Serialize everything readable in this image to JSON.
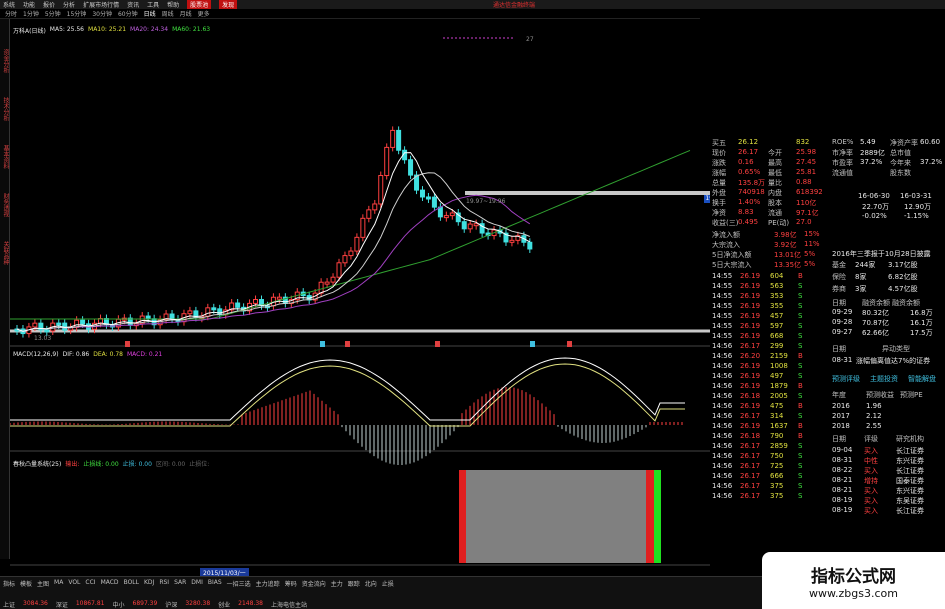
{
  "menubar": {
    "items": [
      "系统",
      "功能",
      "报价",
      "分析",
      "扩展市场行情",
      "资讯",
      "工具",
      "帮助"
    ],
    "btn1": "股票池",
    "btn2": "发现",
    "brand": "通达信金融终端"
  },
  "periodbar": {
    "items": [
      "分时",
      "1分钟",
      "5分钟",
      "15分钟",
      "30分钟",
      "60分钟",
      "日线",
      "周线",
      "月线",
      "更多"
    ],
    "active_index": 6
  },
  "sidebar": {
    "items": [
      "资金分析",
      "技术分析",
      "基本资料",
      "财务透视",
      "关联品种"
    ]
  },
  "ma_legend": {
    "title": "万科A(日线)",
    "ma5": "MA5: 25.56",
    "ma10": "MA10: 25.21",
    "ma20": "MA20: 24.34",
    "ma60": "MA60: 21.63"
  },
  "main_chart": {
    "high_label": "27",
    "annotation": "19.97~19.96",
    "low_label": "13.03",
    "price_tag": "19.36"
  },
  "macd_legend": {
    "name": "MACD(12,26,9)",
    "dif": "DIF: 0.86",
    "dea": "DEA: 0.78",
    "macd": "MACD: 0.21"
  },
  "ind_legend": {
    "name": "春秋凸量系统(25)",
    "a": "输出:",
    "b": "止损线: 0.00",
    "c": "止损: 0.00",
    "d": "区间: 0.00",
    "e": "止损位:"
  },
  "date_box": "2015/11/03/一",
  "right_panel": {
    "quote": [
      {
        "label": "买五",
        "value": "26.12",
        "vol": "832"
      },
      {
        "label": "现价",
        "value": "26.17",
        "l2": "今开",
        "v2": "25.98"
      },
      {
        "label": "涨跌",
        "value": "0.16",
        "l2": "最高",
        "v2": "27.45"
      },
      {
        "label": "涨幅",
        "value": "0.65%",
        "l2": "最低",
        "v2": "25.81"
      },
      {
        "label": "总量",
        "value": "135.8万",
        "l2": "量比",
        "v2": "0.88"
      },
      {
        "label": "外盘",
        "value": "740918",
        "l2": "内盘",
        "v2": "618392"
      },
      {
        "label": "换手",
        "value": "1.40%",
        "l2": "股本",
        "v2": "110亿"
      },
      {
        "label": "净资",
        "value": "8.83",
        "l2": "流通",
        "v2": "97.1亿"
      },
      {
        "label": "收益(三)",
        "value": "0.495",
        "l2": "PE(动)",
        "v2": "27.0"
      }
    ],
    "flows": [
      {
        "label": "净流入额",
        "value": "3.98亿",
        "pct": "15%"
      },
      {
        "label": "大宗流入",
        "value": "3.92亿",
        "pct": "11%"
      },
      {
        "label": "5日净流入额",
        "value": "13.01亿",
        "pct": "5%"
      },
      {
        "label": "5日大宗流入",
        "value": "13.35亿",
        "pct": "5%"
      }
    ],
    "ticks": [
      [
        "14:55",
        "26.19",
        "604",
        "B"
      ],
      [
        "14:55",
        "26.19",
        "563",
        "S"
      ],
      [
        "14:55",
        "26.19",
        "353",
        "S"
      ],
      [
        "14:55",
        "26.19",
        "355",
        "S"
      ],
      [
        "14:55",
        "26.19",
        "457",
        "S"
      ],
      [
        "14:55",
        "26.19",
        "597",
        "S"
      ],
      [
        "14:55",
        "26.19",
        "668",
        "S"
      ],
      [
        "14:56",
        "26.17",
        "299",
        "S"
      ],
      [
        "14:56",
        "26.20",
        "2159",
        "B"
      ],
      [
        "14:56",
        "26.19",
        "1008",
        "S"
      ],
      [
        "14:56",
        "26.19",
        "497",
        "S"
      ],
      [
        "14:56",
        "26.19",
        "1879",
        "B"
      ],
      [
        "14:56",
        "26.18",
        "2005",
        "S"
      ],
      [
        "14:56",
        "26.19",
        "475",
        "B"
      ],
      [
        "14:56",
        "26.17",
        "314",
        "S"
      ],
      [
        "14:56",
        "26.19",
        "1637",
        "B"
      ],
      [
        "14:56",
        "26.18",
        "790",
        "B"
      ],
      [
        "14:56",
        "26.17",
        "2859",
        "S"
      ],
      [
        "14:56",
        "26.17",
        "750",
        "S"
      ],
      [
        "14:56",
        "26.17",
        "725",
        "S"
      ],
      [
        "14:56",
        "26.17",
        "666",
        "S"
      ],
      [
        "14:56",
        "26.17",
        "375",
        "S"
      ],
      [
        "14:56",
        "26.17",
        "375",
        "S"
      ]
    ],
    "f10": {
      "rows": [
        [
          "ROE%",
          "5.49",
          "净资产率",
          "60.60"
        ],
        [
          "市净率",
          "2889亿",
          "总市值",
          ""
        ],
        [
          "市盈率",
          "37.2%",
          "今年来",
          "37.2%"
        ],
        [
          "流通值",
          "",
          "股东数",
          ""
        ]
      ],
      "dates": [
        [
          "16-06-30",
          "16-03-31"
        ]
      ],
      "vals": [
        [
          "22.70万",
          "12.90万"
        ],
        [
          "-0.02%",
          "-1.15%"
        ]
      ],
      "report": "2016年三季报于10月28日披露",
      "cats": [
        [
          "基金",
          "244家",
          "3.17亿股"
        ],
        [
          "保险",
          "8家",
          "6.82亿股"
        ],
        [
          "券商",
          "3家",
          "4.57亿股"
        ]
      ],
      "margin_header": [
        "日期",
        "融资余额",
        "融资余额"
      ],
      "margin": [
        [
          "09-29",
          "80.32亿",
          "16.8万"
        ],
        [
          "09-28",
          "70.87亿",
          "16.1万"
        ],
        [
          "09-27",
          "62.66亿",
          "17.5万"
        ]
      ],
      "event_header": [
        "日期",
        "异动类型"
      ],
      "event": [
        "08-31",
        "涨幅偏离值达7%的证券"
      ],
      "tabs": [
        "预测评级",
        "主题投资",
        "智能解盘"
      ],
      "forecast_header": [
        "年度",
        "预测收益",
        "预测PE"
      ],
      "forecast": [
        [
          "2016",
          "1.96",
          ""
        ],
        [
          "2017",
          "2.12",
          ""
        ],
        [
          "2018",
          "2.55",
          ""
        ]
      ],
      "rating_header": [
        "日期",
        "评级",
        "研究机构"
      ],
      "ratings": [
        [
          "09-04",
          "买入",
          "长江证券"
        ],
        [
          "08-31",
          "中性",
          "东兴证券"
        ],
        [
          "08-22",
          "买入",
          "长江证券"
        ],
        [
          "08-21",
          "增持",
          "国泰证券"
        ],
        [
          "08-21",
          "买入",
          "东兴证券"
        ],
        [
          "08-19",
          "买入",
          "东吴证券"
        ],
        [
          "08-19",
          "买入",
          "长江证券"
        ]
      ]
    }
  },
  "bottom": {
    "tools": [
      "指标",
      "模板",
      "主图",
      "MA",
      "VOL",
      "CCI",
      "MACD",
      "BOLL",
      "KDJ",
      "RSI",
      "SAR",
      "DMI",
      "BIAS",
      "一招三选",
      "主力追踪",
      "筹码",
      "资金流向",
      "主力",
      "跟踪",
      "北向",
      "止损"
    ],
    "indices": [
      {
        "name": "上证",
        "value": "3084.36"
      },
      {
        "name": "深证",
        "value": "10867.81"
      },
      {
        "name": "中小",
        "value": "6897.39"
      },
      {
        "name": "沪深",
        "value": "3280.38"
      },
      {
        "name": "创业",
        "value": "2148.38"
      },
      {
        "name": "上海电信主站"
      }
    ]
  },
  "watermark": {
    "line1": "指标公式网",
    "line2": "www.zbgs3.com"
  },
  "colors": {
    "up": "#ff4040",
    "down": "#40e0e0",
    "ma5": "#ffffff",
    "ma10": "#d0d0d0",
    "ma20": "#a040c0",
    "ma60": "#30a030"
  }
}
